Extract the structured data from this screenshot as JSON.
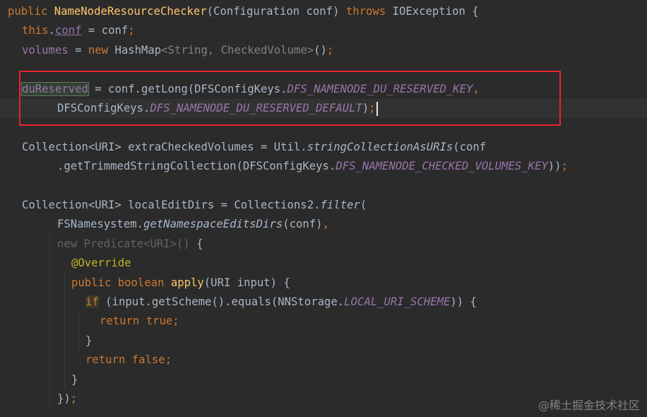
{
  "colors": {
    "background": "#2b2b2b",
    "keyword": "#cc7832",
    "method_name": "#ffc66d",
    "field_constant": "#9876aa",
    "annotation": "#bbb529",
    "plain": "#a9b7c6",
    "muted": "#808080",
    "highlight_box": "#e8232c"
  },
  "watermark": "@稀土掘金技术社区",
  "code_lines": [
    {
      "id": "line-1",
      "indent": 0,
      "tokens": [
        {
          "t": "public",
          "c": "kw"
        },
        {
          "t": " ",
          "c": "pl"
        },
        {
          "t": "NameNodeResourceChecker",
          "c": "fn"
        },
        {
          "t": "(",
          "c": "pl"
        },
        {
          "t": "Configuration",
          "c": "tp"
        },
        {
          "t": " conf) ",
          "c": "pl"
        },
        {
          "t": "throws",
          "c": "kw"
        },
        {
          "t": " IOException {",
          "c": "pl"
        }
      ]
    },
    {
      "id": "line-2",
      "indent": 2,
      "tokens": [
        {
          "t": "this",
          "c": "kw"
        },
        {
          "t": ".",
          "c": "pl"
        },
        {
          "t": "conf",
          "c": "fld ul"
        },
        {
          "t": " = conf",
          "c": "pl"
        },
        {
          "t": ";",
          "c": "kw"
        }
      ]
    },
    {
      "id": "line-3",
      "indent": 2,
      "tokens": [
        {
          "t": "volumes",
          "c": "fld"
        },
        {
          "t": " = ",
          "c": "pl"
        },
        {
          "t": "new",
          "c": "kw"
        },
        {
          "t": " HashMap",
          "c": "tp"
        },
        {
          "t": "<String, CheckedVolume>",
          "c": "gen"
        },
        {
          "t": "()",
          "c": "pl"
        },
        {
          "t": ";",
          "c": "kw"
        }
      ]
    },
    {
      "id": "line-4",
      "indent": 0,
      "tokens": []
    },
    {
      "id": "line-5",
      "indent": 2,
      "tokens": [
        {
          "t": "duReserved",
          "c": "fld hlvar"
        },
        {
          "t": " = conf.getLong(DFSConfigKeys.",
          "c": "pl"
        },
        {
          "t": "DFS_NAMENODE_DU_RESERVED_KEY",
          "c": "cst"
        },
        {
          "t": ",",
          "c": "kw"
        }
      ]
    },
    {
      "id": "line-6",
      "indent": 7,
      "current": true,
      "tokens": [
        {
          "t": "DFSConfigKeys.",
          "c": "pl"
        },
        {
          "t": "DFS_NAMENODE_DU_RESERVED_DEFAULT",
          "c": "cst"
        },
        {
          "t": ")",
          "c": "pl"
        },
        {
          "t": ";",
          "c": "kw"
        }
      ]
    },
    {
      "id": "line-7",
      "indent": 0,
      "tokens": []
    },
    {
      "id": "line-8",
      "indent": 2,
      "tokens": [
        {
          "t": "Collection<URI> extraCheckedVolumes = Util.",
          "c": "pl"
        },
        {
          "t": "stringCollectionAsURIs",
          "c": "sm"
        },
        {
          "t": "(conf",
          "c": "pl"
        }
      ]
    },
    {
      "id": "line-9",
      "indent": 7,
      "tokens": [
        {
          "t": ".getTrimmedStringCollection(DFSConfigKeys.",
          "c": "pl"
        },
        {
          "t": "DFS_NAMENODE_CHECKED_VOLUMES_KEY",
          "c": "cst"
        },
        {
          "t": "))",
          "c": "pl"
        },
        {
          "t": ";",
          "c": "kw"
        }
      ]
    },
    {
      "id": "line-10",
      "indent": 0,
      "tokens": []
    },
    {
      "id": "line-11",
      "indent": 2,
      "tokens": [
        {
          "t": "Collection<URI> localEditDirs = Collections2.",
          "c": "pl"
        },
        {
          "t": "filter",
          "c": "sm"
        },
        {
          "t": "(",
          "c": "pl"
        }
      ]
    },
    {
      "id": "line-12",
      "indent": 7,
      "tokens": [
        {
          "t": "FSNamesystem.",
          "c": "pl"
        },
        {
          "t": "getNamespaceEditsDirs",
          "c": "sm"
        },
        {
          "t": "(conf)",
          "c": "pl"
        },
        {
          "t": ",",
          "c": "kw"
        }
      ]
    },
    {
      "id": "line-13",
      "indent": 7,
      "tokens": [
        {
          "t": "new",
          "c": "dim"
        },
        {
          "t": " Predicate<URI>() ",
          "c": "dim"
        },
        {
          "t": "{",
          "c": "pl"
        }
      ]
    },
    {
      "id": "line-14",
      "indent": 9,
      "tokens": [
        {
          "t": "@Override",
          "c": "ann"
        }
      ]
    },
    {
      "id": "line-15",
      "indent": 9,
      "tokens": [
        {
          "t": "public",
          "c": "kw"
        },
        {
          "t": " ",
          "c": "pl"
        },
        {
          "t": "boolean",
          "c": "kw"
        },
        {
          "t": " ",
          "c": "pl"
        },
        {
          "t": "apply",
          "c": "fn"
        },
        {
          "t": "(URI input) {",
          "c": "pl"
        }
      ]
    },
    {
      "id": "line-16",
      "indent": 11,
      "tokens": [
        {
          "t": "if",
          "c": "kw hlkw"
        },
        {
          "t": " (input.getScheme().equals(NNStorage.",
          "c": "pl"
        },
        {
          "t": "LOCAL_URI_SCHEME",
          "c": "cst"
        },
        {
          "t": ")) {",
          "c": "pl"
        }
      ]
    },
    {
      "id": "line-17",
      "indent": 13,
      "tokens": [
        {
          "t": "return",
          "c": "kw"
        },
        {
          "t": " ",
          "c": "pl"
        },
        {
          "t": "true",
          "c": "kw"
        },
        {
          "t": ";",
          "c": "kw"
        }
      ]
    },
    {
      "id": "line-18",
      "indent": 11,
      "tokens": [
        {
          "t": "}",
          "c": "pl"
        }
      ]
    },
    {
      "id": "line-19",
      "indent": 11,
      "tokens": [
        {
          "t": "return",
          "c": "kw"
        },
        {
          "t": " ",
          "c": "pl"
        },
        {
          "t": "false",
          "c": "kw"
        },
        {
          "t": ";",
          "c": "kw"
        }
      ]
    },
    {
      "id": "line-20",
      "indent": 9,
      "tokens": [
        {
          "t": "}",
          "c": "pl"
        }
      ]
    },
    {
      "id": "line-21",
      "indent": 7,
      "tokens": [
        {
          "t": "})",
          "c": "pl"
        },
        {
          "t": ";",
          "c": "kw"
        }
      ]
    }
  ]
}
